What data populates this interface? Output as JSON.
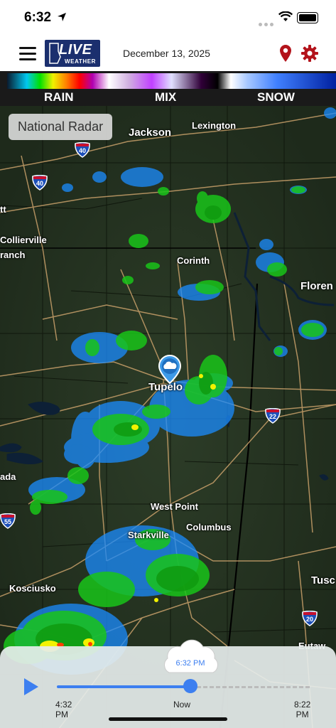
{
  "status": {
    "time": "6:32"
  },
  "header": {
    "logo_main": "LIVE",
    "logo_sub": "WEATHER",
    "date": "December 13, 2025"
  },
  "legend": {
    "rain": "RAIN",
    "mix": "MIX",
    "snow": "SNOW"
  },
  "map": {
    "mode_button": "National Radar",
    "cities": {
      "jackson": "Jackson",
      "lexington": "Lexington",
      "collierville": "Collierville",
      "branch": "ranch",
      "att": "tt",
      "corinth": "Corinth",
      "florence": "Floren",
      "tupelo": "Tupelo",
      "grenada": "ada",
      "west_point": "West Point",
      "columbus": "Columbus",
      "starkville": "Starkville",
      "kosciusko": "Kosciusko",
      "tuscaloosa": "Tusc",
      "eutaw": "Eutaw"
    },
    "shields": {
      "i40a": "40",
      "i40b": "40",
      "i22": "22",
      "i55": "55",
      "i20": "20"
    }
  },
  "timeline": {
    "current": "6:32 PM",
    "start_time": "4:32",
    "start_ampm": "PM",
    "now": "Now",
    "end_time": "8:22",
    "end_ampm": "PM",
    "progress": 0.55
  },
  "colors": {
    "accent": "#3d7ff0",
    "brand_red": "#b3131b",
    "logo_blue": "#1b2f6e"
  }
}
